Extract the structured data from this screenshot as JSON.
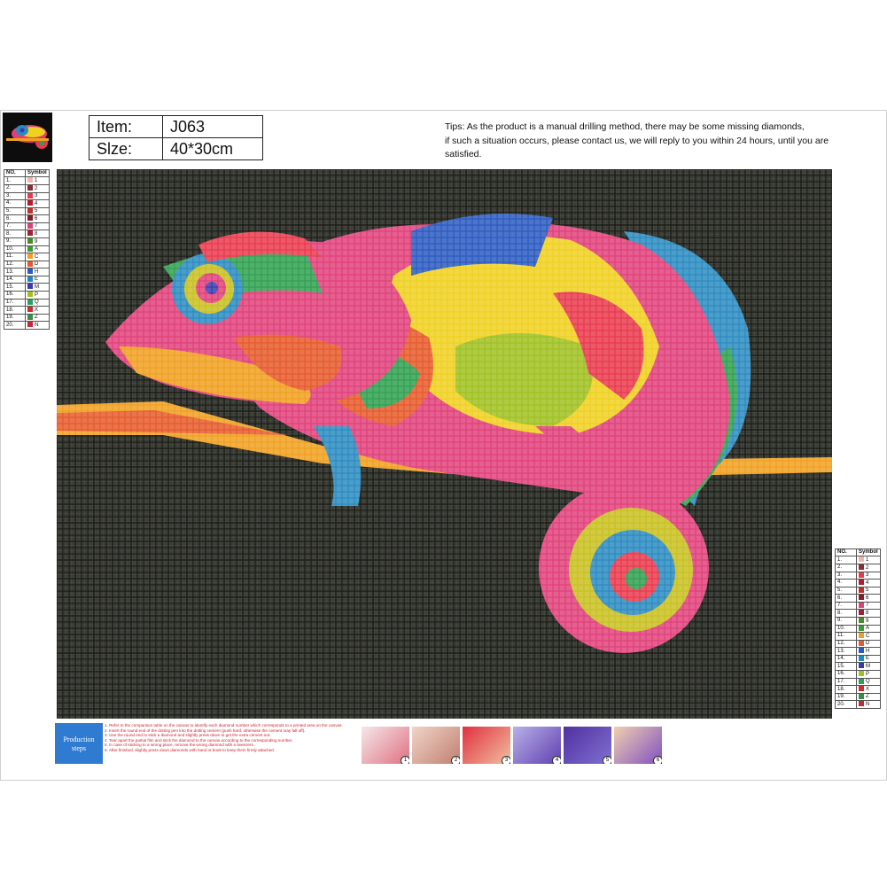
{
  "item": {
    "label": "Item:",
    "value": "J063"
  },
  "size": {
    "label": "Slze:",
    "value": "40*30cm"
  },
  "tips": [
    "Tips: As the product is a manual drilling method, there may be some missing diamonds,",
    " if such a situation occurs, please contact us, we will reply to you within 24 hours, until you are",
    "satisfied."
  ],
  "symbol_table": {
    "header_no": "NO.",
    "header_symbol": "Symbol",
    "rows": [
      {
        "no": "1.",
        "symbol": "1",
        "color": "#f2b6b0"
      },
      {
        "no": "2.",
        "symbol": "2",
        "color": "#8a2c33"
      },
      {
        "no": "3.",
        "symbol": "3",
        "color": "#e83a4c"
      },
      {
        "no": "4.",
        "symbol": "4",
        "color": "#b31d2a"
      },
      {
        "no": "5.",
        "symbol": "5",
        "color": "#c0312b"
      },
      {
        "no": "6.",
        "symbol": "6",
        "color": "#8a1b2a"
      },
      {
        "no": "7.",
        "symbol": "7",
        "color": "#e0407a"
      },
      {
        "no": "8.",
        "symbol": "8",
        "color": "#a0203a"
      },
      {
        "no": "9.",
        "symbol": "9",
        "color": "#4a8a2a"
      },
      {
        "no": "10.",
        "symbol": "A",
        "color": "#3a9a3a"
      },
      {
        "no": "11.",
        "symbol": "C",
        "color": "#f0a020"
      },
      {
        "no": "12.",
        "symbol": "D",
        "color": "#e65a2a"
      },
      {
        "no": "13.",
        "symbol": "H",
        "color": "#2a5ac0"
      },
      {
        "no": "14.",
        "symbol": "E",
        "color": "#1a8ac0"
      },
      {
        "no": "15.",
        "symbol": "M",
        "color": "#3a3ab0"
      },
      {
        "no": "16.",
        "symbol": "P",
        "color": "#a0c020"
      },
      {
        "no": "17.",
        "symbol": "Q",
        "color": "#2aa060"
      },
      {
        "no": "18.",
        "symbol": "X",
        "color": "#d02a2a"
      },
      {
        "no": "19.",
        "symbol": "Z",
        "color": "#3a8a4a"
      },
      {
        "no": "20.",
        "symbol": "N",
        "color": "#c02a3a"
      }
    ]
  },
  "production": {
    "label_line1": "Production",
    "label_line2": "steps",
    "steps": [
      "1. Refer to the comparison table on the canvas to identify each diamond number which corresponds to a printed area on the canvas.",
      "2. Insert the round end of the dotting pen into the dotting cement (push hard, otherwise the cement may fall off).",
      "3. Use the round end to stick a diamond and slightly press down to get the extra cement out.",
      "4. Tear apart the partial film and stick the diamond to the canvas according to the corresponding number.",
      "5. In case of sticking to a wrong place, remove the wrong diamond with a tweezers.",
      "6. After finished, slightly press down diamonds with hand or book to keep them firmly attached."
    ],
    "photo_numbers": [
      "1",
      "2",
      "3",
      "4",
      "5",
      "6"
    ]
  },
  "colors": {
    "canvas_bg": "#12140f",
    "production_box": "#2f7bd2",
    "steps_text": "#d0202a"
  }
}
